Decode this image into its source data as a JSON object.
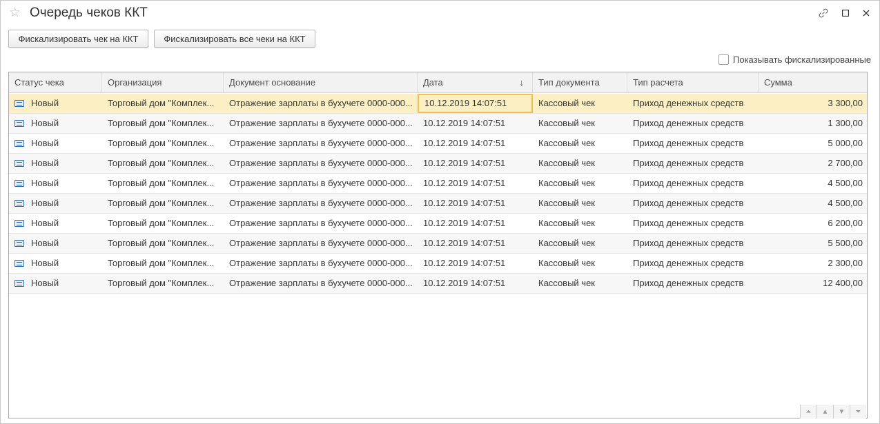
{
  "window": {
    "title": "Очередь чеков ККТ"
  },
  "toolbar": {
    "fiscalize_one_label": "Фискализировать чек на ККТ",
    "fiscalize_all_label": "Фискализировать все чеки на ККТ"
  },
  "filter": {
    "show_fiscalized_label": "Показывать фискализированные",
    "show_fiscalized_checked": false
  },
  "table": {
    "columns": [
      "Статус чека",
      "Организация",
      "Документ основание",
      "Дата",
      "Тип документа",
      "Тип расчета",
      "Сумма"
    ],
    "sort_icon": "sort-descending-icon",
    "rows": [
      [
        "Новый",
        "Торговый дом \"Комплек...",
        "Отражение зарплаты в бухучете 0000-000...",
        "10.12.2019 14:07:51",
        "Кассовый чек",
        "Приход денежных средств",
        "3 300,00"
      ],
      [
        "Новый",
        "Торговый дом \"Комплек...",
        "Отражение зарплаты в бухучете 0000-000...",
        "10.12.2019 14:07:51",
        "Кассовый чек",
        "Приход денежных средств",
        "1 300,00"
      ],
      [
        "Новый",
        "Торговый дом \"Комплек...",
        "Отражение зарплаты в бухучете 0000-000...",
        "10.12.2019 14:07:51",
        "Кассовый чек",
        "Приход денежных средств",
        "5 000,00"
      ],
      [
        "Новый",
        "Торговый дом \"Комплек...",
        "Отражение зарплаты в бухучете 0000-000...",
        "10.12.2019 14:07:51",
        "Кассовый чек",
        "Приход денежных средств",
        "2 700,00"
      ],
      [
        "Новый",
        "Торговый дом \"Комплек...",
        "Отражение зарплаты в бухучете 0000-000...",
        "10.12.2019 14:07:51",
        "Кассовый чек",
        "Приход денежных средств",
        "4 500,00"
      ],
      [
        "Новый",
        "Торговый дом \"Комплек...",
        "Отражение зарплаты в бухучете 0000-000...",
        "10.12.2019 14:07:51",
        "Кассовый чек",
        "Приход денежных средств",
        "4 500,00"
      ],
      [
        "Новый",
        "Торговый дом \"Комплек...",
        "Отражение зарплаты в бухучете 0000-000...",
        "10.12.2019 14:07:51",
        "Кассовый чек",
        "Приход денежных средств",
        "6 200,00"
      ],
      [
        "Новый",
        "Торговый дом \"Комплек...",
        "Отражение зарплаты в бухучете 0000-000...",
        "10.12.2019 14:07:51",
        "Кассовый чек",
        "Приход денежных средств",
        "5 500,00"
      ],
      [
        "Новый",
        "Торговый дом \"Комплек...",
        "Отражение зарплаты в бухучете 0000-000...",
        "10.12.2019 14:07:51",
        "Кассовый чек",
        "Приход денежных средств",
        "2 300,00"
      ],
      [
        "Новый",
        "Торговый дом \"Комплек...",
        "Отражение зарплаты в бухучете 0000-000...",
        "10.12.2019 14:07:51",
        "Кассовый чек",
        "Приход денежных средств",
        "12 400,00"
      ]
    ],
    "selected_row": 0
  },
  "icons": {
    "favorite": "star-icon",
    "link": "link-icon",
    "maximize": "maximize-icon",
    "close": "close-icon",
    "status": "receipt-status-icon"
  },
  "colors": {
    "selected_row": "#fbefc3",
    "focus_border": "#f0c14b"
  }
}
